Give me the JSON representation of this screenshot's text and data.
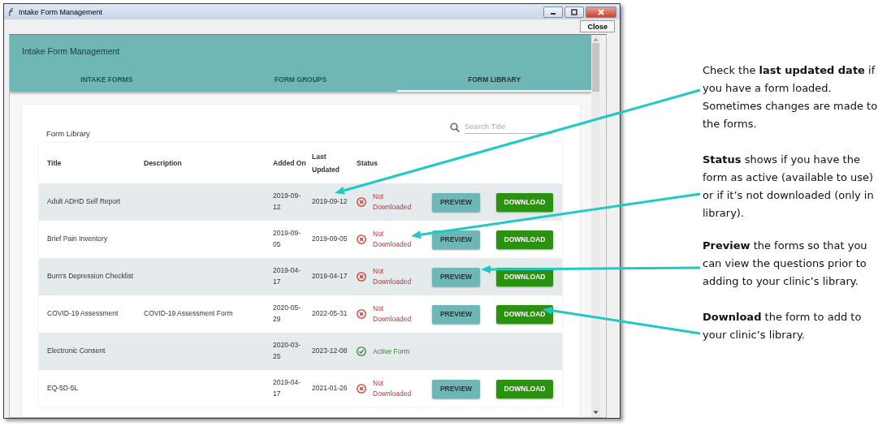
{
  "window": {
    "title": "Intake Form Management",
    "close_button": "Close"
  },
  "app": {
    "title": "Intake Form Management"
  },
  "tabs": [
    {
      "label": "INTAKE FORMS",
      "selected": false
    },
    {
      "label": "FORM GROUPS",
      "selected": false
    },
    {
      "label": "FORM LIBRARY",
      "selected": true
    }
  ],
  "library": {
    "title": "Form Library",
    "search": {
      "placeholder": "Search Title"
    },
    "columns": [
      "Title",
      "Description",
      "Added On",
      "Last Updated",
      "Status"
    ],
    "rows": [
      {
        "title": "Adult ADHD Self Report",
        "added_on": "2019-09-12",
        "last_updated": "2019-09-12",
        "status": {
          "kind": "not_downloaded",
          "label": "Not Downloaded"
        },
        "actions": [
          "PREVIEW",
          "DOWNLOAD"
        ]
      },
      {
        "title": "Brief Pain Inventory",
        "added_on": "2019-09-05",
        "last_updated": "2019-09-05",
        "status": {
          "kind": "not_downloaded",
          "label": "Not Downloaded"
        },
        "actions": [
          "PREVIEW",
          "DOWNLOAD"
        ]
      },
      {
        "title": "Burn's Depression Checklist",
        "added_on": "2019-04-17",
        "last_updated": "2019-04-17",
        "status": {
          "kind": "not_downloaded",
          "label": "Not Downloaded"
        },
        "actions": [
          "PREVIEW",
          "DOWNLOAD"
        ]
      },
      {
        "title": "COVID-19 Assessment",
        "description": "COVID-19 Assessment Form",
        "added_on": "2020-05-29",
        "last_updated": "2022-05-31",
        "status": {
          "kind": "not_downloaded",
          "label": "Not Downloaded"
        },
        "actions": [
          "PREVIEW",
          "DOWNLOAD"
        ]
      },
      {
        "title": "Electronic Consent",
        "added_on": "2020-03-25",
        "last_updated": "2023-12-08",
        "status": {
          "kind": "active",
          "label": "Active Form"
        }
      },
      {
        "title": "EQ-5D-5L",
        "added_on": "2019-04-17",
        "last_updated": "2021-01-26",
        "status": {
          "kind": "not_downloaded",
          "label": "Not Downloaded"
        },
        "actions": [
          "PREVIEW",
          "DOWNLOAD"
        ]
      }
    ]
  },
  "callouts": [
    {
      "text": "Check the **last updated date** if you have a form loaded. Sometimes changes are made to the forms."
    },
    {
      "text": "**Status** shows if you have the form as active (available to use) or if it’s not downloaded (only in library)."
    },
    {
      "text": "**Preview** the forms so that you can view the questions prior to adding to your clinic’s library."
    },
    {
      "text": "**Download** the form to add to your clinic’s library."
    }
  ]
}
